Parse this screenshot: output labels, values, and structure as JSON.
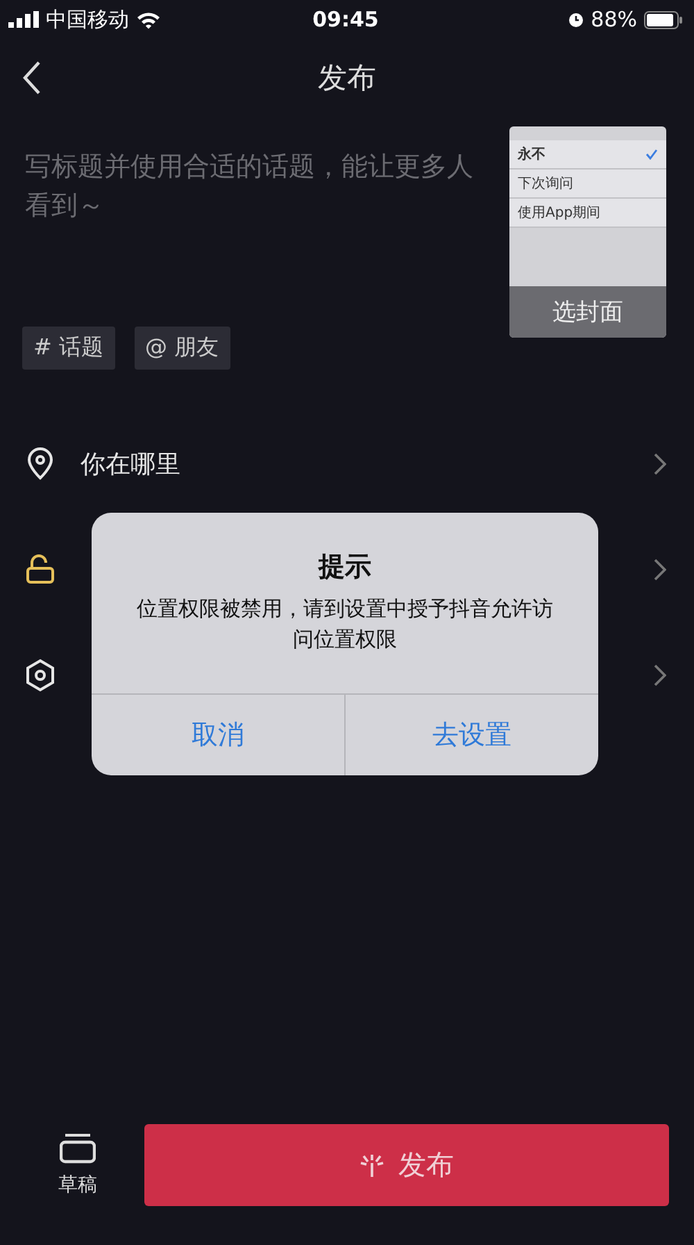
{
  "status_bar": {
    "carrier": "中国移动",
    "time": "09:45",
    "battery": "88%"
  },
  "nav": {
    "title": "发布"
  },
  "caption": {
    "placeholder": "写标题并使用合适的话题，能让更多人看到～"
  },
  "tags": [
    {
      "symbol": "#",
      "label": "话题"
    },
    {
      "symbol": "@",
      "label": "朋友"
    }
  ],
  "cover": {
    "options": [
      {
        "label": "永不",
        "selected": true
      },
      {
        "label": "下次询问",
        "selected": false
      },
      {
        "label": "使用App期间",
        "selected": false
      }
    ],
    "button": "选封面"
  },
  "rows": [
    {
      "kind": "location",
      "label": "你在哪里",
      "highlighted": false
    },
    {
      "kind": "lock",
      "highlighted": true
    },
    {
      "kind": "settings",
      "highlighted": false
    }
  ],
  "dialog": {
    "title": "提示",
    "message": "位置权限被禁用，请到设置中授予抖音允许访问位置权限",
    "buttons": [
      "取消",
      "去设置"
    ]
  },
  "footer": {
    "draft": "草稿",
    "publish": "发布"
  }
}
